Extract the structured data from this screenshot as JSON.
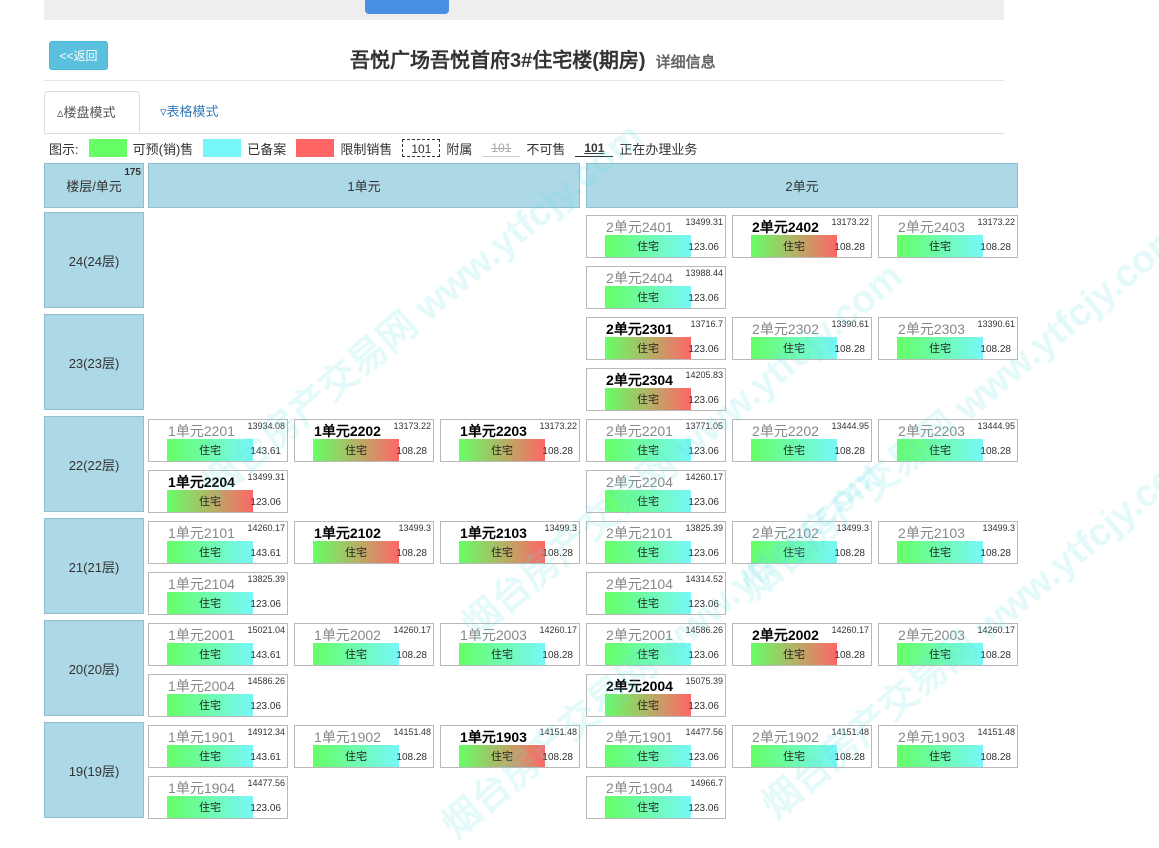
{
  "header": {
    "back_label": "<<返回",
    "title": "吾悦广场吾悦首府3#住宅楼(期房)",
    "subtitle": "详细信息"
  },
  "tabs": {
    "building_mode": "▵楼盘模式",
    "table_mode": "▿表格模式"
  },
  "legend": {
    "label": "图示:",
    "presale": "可预(销)售",
    "filed": "已备案",
    "restricted": "限制销售",
    "sample_num": "101",
    "attached": "附属",
    "not_for_sale": "不可售",
    "in_process": "正在办理业务"
  },
  "grid": {
    "corner": "楼层/单元",
    "corner_num": "175",
    "unit1": "1单元",
    "unit2": "2单元",
    "room_type": "住宅",
    "floors": [
      {
        "label": "24(24层)",
        "unit1": [],
        "unit2": [
          {
            "name": "2单元2401",
            "price": "13499.31",
            "area": "123.06",
            "status": "s"
          },
          {
            "name": "2单元2402",
            "price": "13173.22",
            "area": "108.28",
            "status": "b"
          },
          {
            "name": "2单元2403",
            "price": "13173.22",
            "area": "108.28",
            "status": "s"
          },
          {
            "name": "2单元2404",
            "price": "13988.44",
            "area": "123.06",
            "status": "s"
          }
        ]
      },
      {
        "label": "23(23层)",
        "unit1": [],
        "unit2": [
          {
            "name": "2单元2301",
            "price": "13716.7",
            "area": "123.06",
            "status": "b"
          },
          {
            "name": "2单元2302",
            "price": "13390.61",
            "area": "108.28",
            "status": "s"
          },
          {
            "name": "2单元2303",
            "price": "13390.61",
            "area": "108.28",
            "status": "s"
          },
          {
            "name": "2单元2304",
            "price": "14205.83",
            "area": "123.06",
            "status": "b"
          }
        ]
      },
      {
        "label": "22(22层)",
        "unit1": [
          {
            "name": "1单元2201",
            "price": "13934.08",
            "area": "143.61",
            "status": "s"
          },
          {
            "name": "1单元2202",
            "price": "13173.22",
            "area": "108.28",
            "status": "b"
          },
          {
            "name": "1单元2203",
            "price": "13173.22",
            "area": "108.28",
            "status": "b"
          },
          {
            "name": "1单元2204",
            "price": "13499.31",
            "area": "123.06",
            "status": "b"
          }
        ],
        "unit2": [
          {
            "name": "2单元2201",
            "price": "13771.05",
            "area": "123.06",
            "status": "s"
          },
          {
            "name": "2单元2202",
            "price": "13444.95",
            "area": "108.28",
            "status": "s"
          },
          {
            "name": "2单元2203",
            "price": "13444.95",
            "area": "108.28",
            "status": "s"
          },
          {
            "name": "2单元2204",
            "price": "14260.17",
            "area": "123.06",
            "status": "s"
          }
        ]
      },
      {
        "label": "21(21层)",
        "unit1": [
          {
            "name": "1单元2101",
            "price": "14260.17",
            "area": "143.61",
            "status": "s"
          },
          {
            "name": "1单元2102",
            "price": "13499.3",
            "area": "108.28",
            "status": "b"
          },
          {
            "name": "1单元2103",
            "price": "13499.3",
            "area": "108.28",
            "status": "b"
          },
          {
            "name": "1单元2104",
            "price": "13825.39",
            "area": "123.06",
            "status": "s"
          }
        ],
        "unit2": [
          {
            "name": "2单元2101",
            "price": "13825.39",
            "area": "123.06",
            "status": "s"
          },
          {
            "name": "2单元2102",
            "price": "13499.3",
            "area": "108.28",
            "status": "s"
          },
          {
            "name": "2单元2103",
            "price": "13499.3",
            "area": "108.28",
            "status": "s"
          },
          {
            "name": "2单元2104",
            "price": "14314.52",
            "area": "123.06",
            "status": "s"
          }
        ]
      },
      {
        "label": "20(20层)",
        "unit1": [
          {
            "name": "1单元2001",
            "price": "15021.04",
            "area": "143.61",
            "status": "s"
          },
          {
            "name": "1单元2002",
            "price": "14260.17",
            "area": "108.28",
            "status": "s"
          },
          {
            "name": "1单元2003",
            "price": "14260.17",
            "area": "108.28",
            "status": "s"
          },
          {
            "name": "1单元2004",
            "price": "14586.26",
            "area": "123.06",
            "status": "s"
          }
        ],
        "unit2": [
          {
            "name": "2单元2001",
            "price": "14586.26",
            "area": "123.06",
            "status": "s"
          },
          {
            "name": "2单元2002",
            "price": "14260.17",
            "area": "108.28",
            "status": "b"
          },
          {
            "name": "2单元2003",
            "price": "14260.17",
            "area": "108.28",
            "status": "s"
          },
          {
            "name": "2单元2004",
            "price": "15075.39",
            "area": "123.06",
            "status": "b"
          }
        ]
      },
      {
        "label": "19(19层)",
        "unit1": [
          {
            "name": "1单元1901",
            "price": "14912.34",
            "area": "143.61",
            "status": "s"
          },
          {
            "name": "1单元1902",
            "price": "14151.48",
            "area": "108.28",
            "status": "s"
          },
          {
            "name": "1单元1903",
            "price": "14151.48",
            "area": "108.28",
            "status": "b"
          },
          {
            "name": "1单元1904",
            "price": "14477.56",
            "area": "123.06",
            "status": "s"
          }
        ],
        "unit2": [
          {
            "name": "2单元1901",
            "price": "14477.56",
            "area": "123.06",
            "status": "s"
          },
          {
            "name": "2单元1902",
            "price": "14151.48",
            "area": "108.28",
            "status": "s"
          },
          {
            "name": "2单元1903",
            "price": "14151.48",
            "area": "108.28",
            "status": "s"
          },
          {
            "name": "2单元1904",
            "price": "14966.7",
            "area": "123.06",
            "status": "s"
          }
        ]
      }
    ]
  },
  "watermark": "烟台房产交易网 www.ytfcjy.com"
}
